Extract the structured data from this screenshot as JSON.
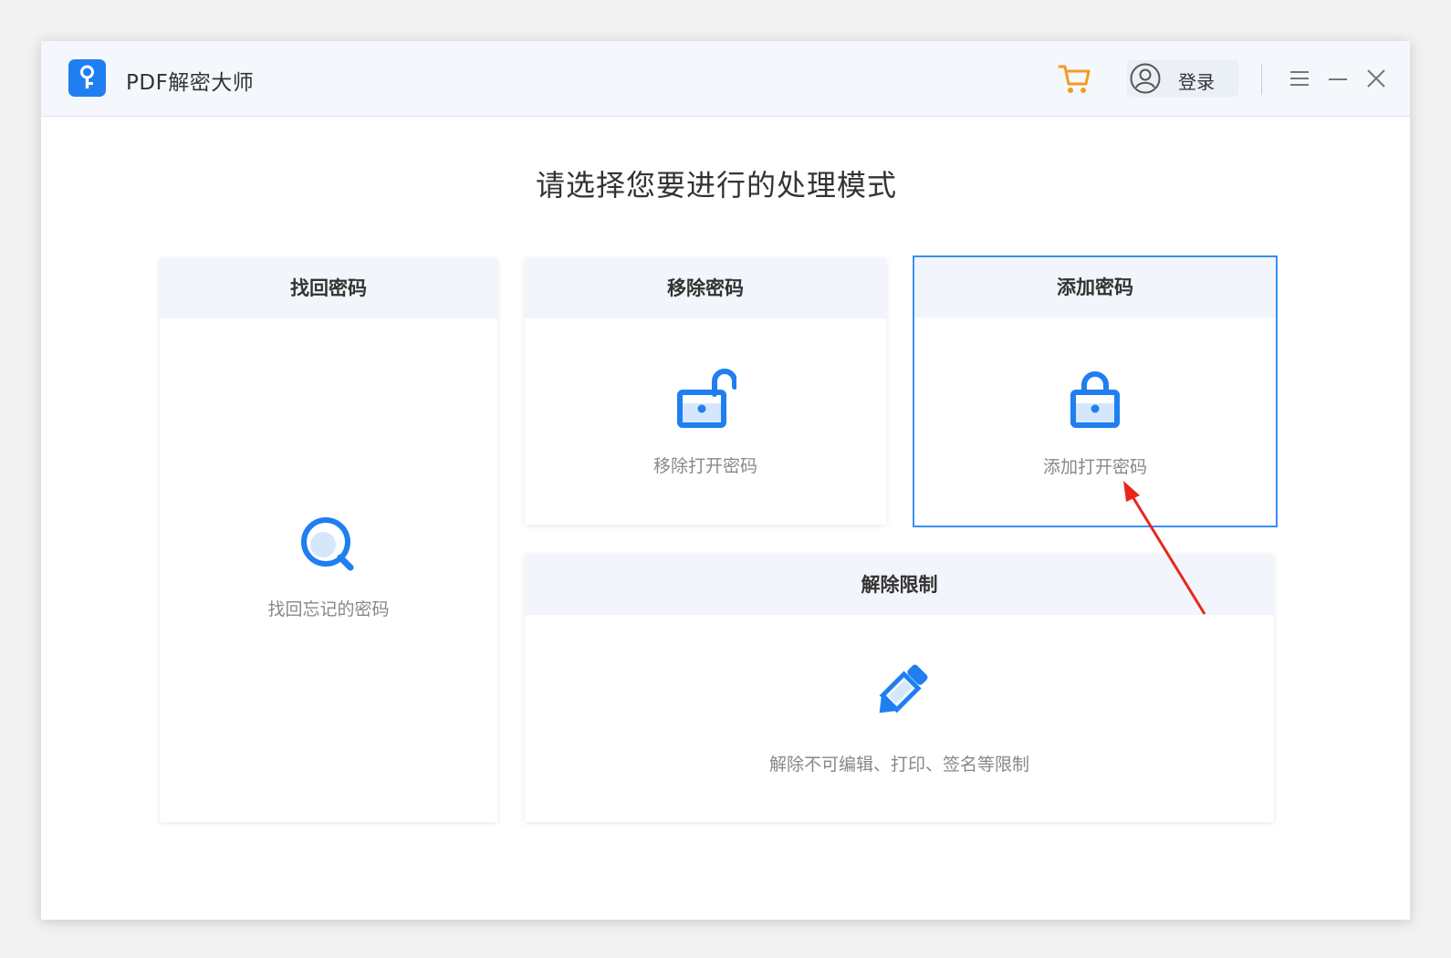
{
  "app": {
    "title": "PDF解密大师",
    "logo_icon": "key-icon",
    "accent_color": "#1f7ff0"
  },
  "titlebar": {
    "cart_icon": "cart-icon",
    "cart_color": "#f59a23",
    "login_label": "登录",
    "avatar_icon": "user-avatar-icon",
    "menu_icon": "menu-icon",
    "minimize_icon": "minimize-icon",
    "close_icon": "close-icon"
  },
  "main": {
    "prompt": "请选择您要进行的处理模式",
    "cards": [
      {
        "title": "找回密码",
        "description": "找回忘记的密码",
        "icon": "magnifier-icon"
      },
      {
        "title": "移除密码",
        "description": "移除打开密码",
        "icon": "unlocked-padlock-icon"
      },
      {
        "title": "添加密码",
        "description": "添加打开密码",
        "icon": "padlock-icon",
        "selected": true
      },
      {
        "title": "解除限制",
        "description": "解除不可编辑、打印、签名等限制",
        "icon": "pencil-icon"
      }
    ]
  },
  "annotation": {
    "arrow_color": "#e8261e"
  }
}
